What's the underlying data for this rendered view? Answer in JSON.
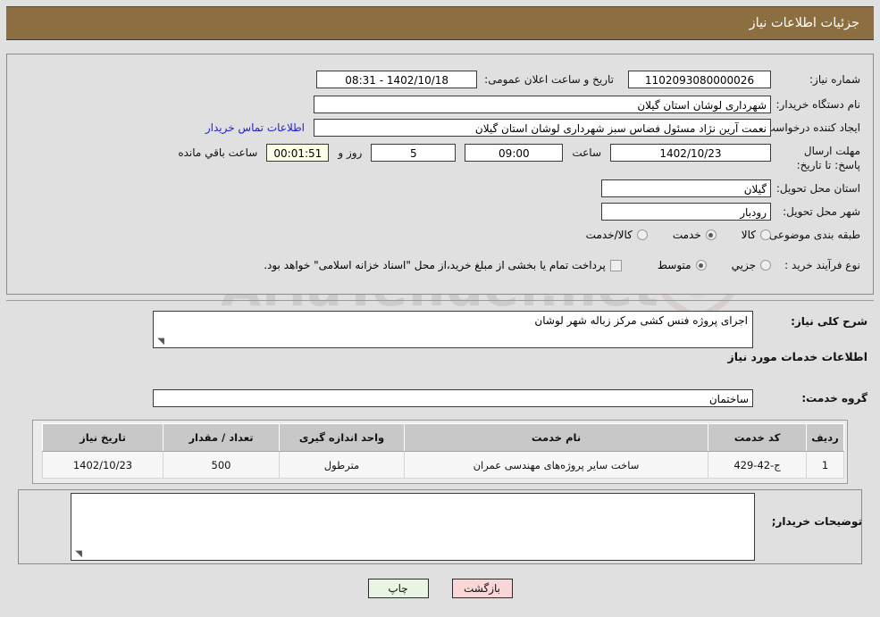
{
  "header": {
    "title": "جزئیات اطلاعات نیاز"
  },
  "watermark": {
    "text": "AriaTender.net"
  },
  "top_form": {
    "need_number_label": "شماره نیاز:",
    "need_number_value": "1102093080000026",
    "public_announce_label": "تاریخ و ساعت اعلان عمومی:",
    "public_announce_value": "1402/10/18 - 08:31",
    "buyer_org_label": "نام دستگاه خریدار:",
    "buyer_org_value": "شهرداری لوشان استان گیلان",
    "creator_label": "ایجاد کننده درخواست:",
    "creator_value": "نعمت آرین نژاد مسئول فضاس سبز شهرداری لوشان استان گیلان",
    "contact_link": "اطلاعات تماس خریدار",
    "deadline_label": "مهلت ارسال پاسخ: تا تاریخ:",
    "deadline_date": "1402/10/23",
    "hour_label": "ساعت",
    "deadline_hour": "09:00",
    "days_remaining": "5",
    "days_label": "روز و",
    "timer_value": "00:01:51",
    "timer_label": "ساعت باقي مانده",
    "province_label": "استان محل تحویل:",
    "province_value": "گیلان",
    "city_label": "شهر محل تحویل:",
    "city_value": "رودبار",
    "category_label": "طبقه بندی موضوعی:",
    "category_options": [
      {
        "label": "کالا",
        "selected": false
      },
      {
        "label": "خدمت",
        "selected": true
      },
      {
        "label": "کالا/خدمت",
        "selected": false
      }
    ],
    "process_label": "نوع فرآیند خرید :",
    "process_options": [
      {
        "label": "جزیي",
        "selected": false
      },
      {
        "label": "متوسط",
        "selected": true
      }
    ],
    "treasury_checked": false,
    "treasury_text": "پرداخت تمام یا بخشی از مبلغ خرید،از محل \"اسناد خزانه اسلامی\" خواهد بود."
  },
  "middle": {
    "general_desc_label": "شرح کلی نیاز:",
    "general_desc_value": "اجرای پروژه فنس کشی مرکز زباله شهر لوشان",
    "services_info_title": "اطلاعات خدمات مورد نیاز",
    "service_group_label": "گروه خدمت:",
    "service_group_value": "ساختمان"
  },
  "table": {
    "columns": [
      "ردیف",
      "کد خدمت",
      "نام خدمت",
      "واحد اندازه گیری",
      "تعداد / مقدار",
      "تاریخ نیاز"
    ],
    "rows": [
      {
        "row": "1",
        "service_code": "ج-42-429",
        "service_name": "ساخت سایر پروژه‌های مهندسی عمران",
        "unit": "مترطول",
        "quantity": "500",
        "need_date": "1402/10/23"
      }
    ]
  },
  "buyer_comments": {
    "label": "توضیحات خریدار;",
    "value": ""
  },
  "buttons": {
    "print": "چاپ",
    "back": "بازگشت"
  },
  "colors": {
    "header_bg": "#8d6e41",
    "page_bg": "#e0e0e0",
    "link": "#2222cc",
    "timer_bg": "#ffffe8",
    "print_bg": "#e8f5e4",
    "back_bg": "#fbd6d6",
    "table_header_bg": "#c8c8c8"
  }
}
